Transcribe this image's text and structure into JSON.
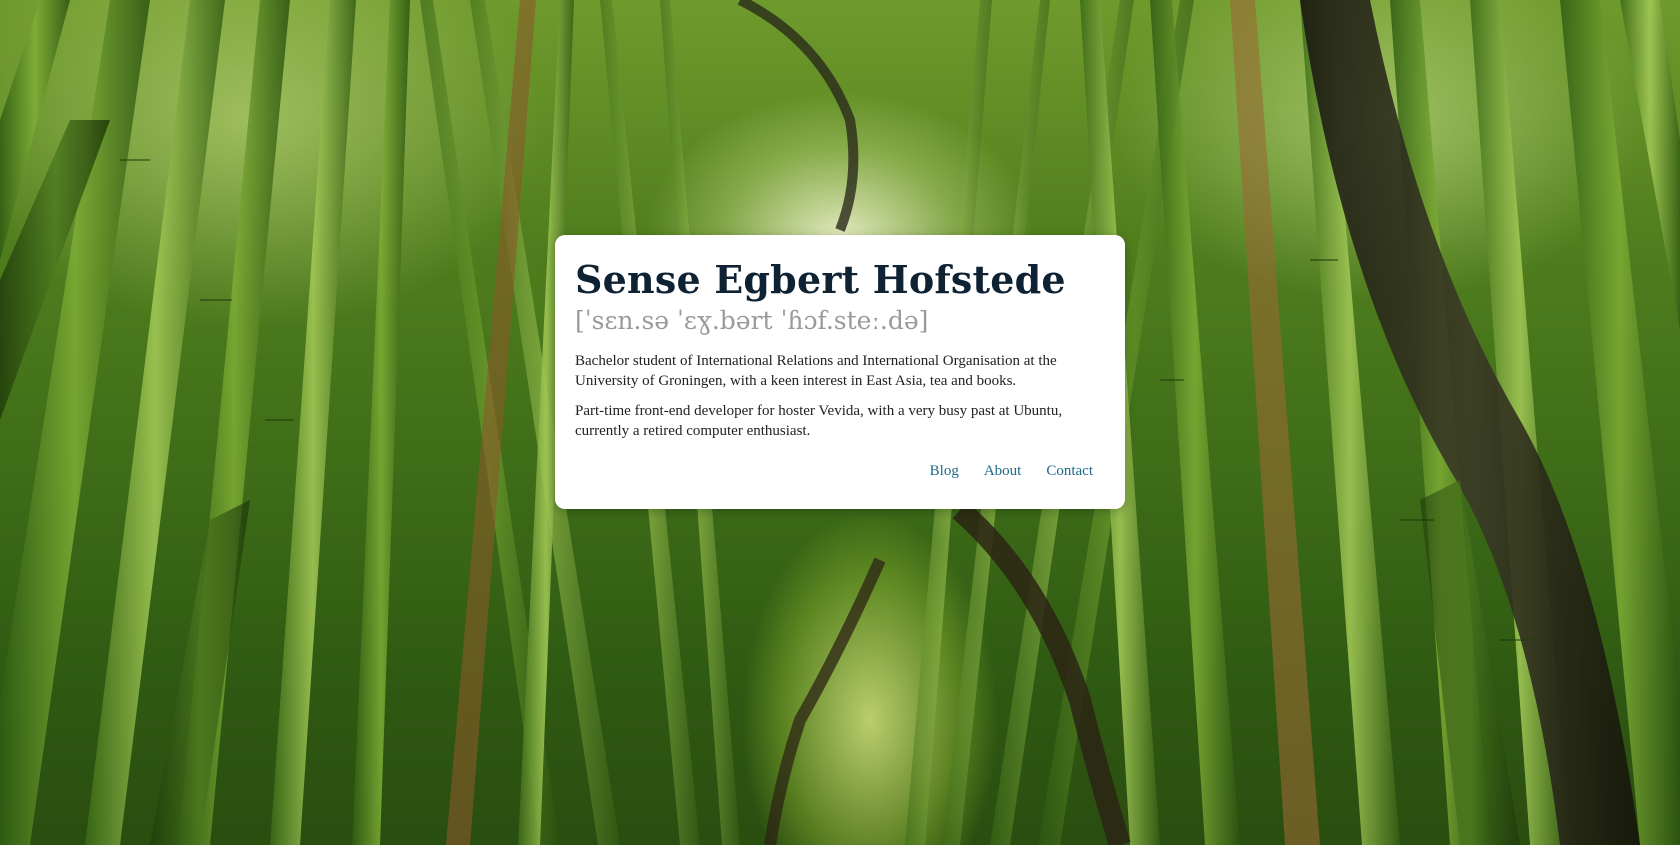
{
  "profile": {
    "name": "Sense Egbert Hofstede",
    "pronunciation": "[ˈsɛn.sə ˈɛɣ.bərt ˈɦɔf.steː.də]",
    "bio_1": "Bachelor student of International Relations and International Organisation at the University of Groningen, with a keen interest in East Asia, tea and books.",
    "bio_2": "Part-time front-end developer for hoster Vevida, with a very busy past at Ubuntu, currently a retired computer enthusiast."
  },
  "nav": {
    "blog": "Blog",
    "about": "About",
    "contact": "Contact"
  },
  "colors": {
    "title": "#0e2233",
    "pronunciation": "#9a9a9a",
    "link": "#1f6a8a",
    "card_background": "#ffffff"
  }
}
